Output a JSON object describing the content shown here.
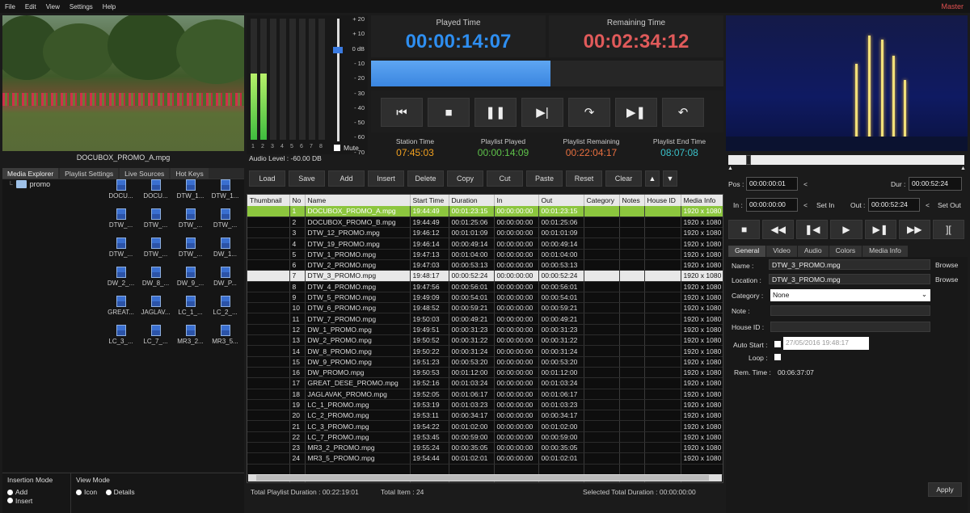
{
  "menu": {
    "items": [
      "File",
      "Edit",
      "View",
      "Settings",
      "Help"
    ],
    "mode": "Master"
  },
  "preview": {
    "caption": "DOCUBOX_PROMO_A.mpg"
  },
  "media_tabs": [
    "Media Explorer",
    "Playlist Settings",
    "Live Sources",
    "Hot Keys"
  ],
  "explorer": {
    "folder": "promo",
    "files": [
      "DOCU...",
      "DOCU...",
      "DTW_1...",
      "DTW_1...",
      "DTW_...",
      "DTW_...",
      "DTW_...",
      "DTW_...",
      "DTW_...",
      "DTW_...",
      "DTW_...",
      "DW_1...",
      "DW_2_...",
      "DW_8_...",
      "DW_9_...",
      "DW_P...",
      "GREAT...",
      "JAGLAV...",
      "LC_1_...",
      "LC_2_...",
      "LC_3_...",
      "LC_7_...",
      "MR3_2...",
      "MR3_5..."
    ]
  },
  "modes": {
    "insertion_title": "Insertion Mode",
    "insertion": [
      "Add",
      "Insert"
    ],
    "view_title": "View Mode",
    "view": [
      "Icon",
      "Details"
    ]
  },
  "audio": {
    "level_label": "Audio Level :",
    "level_value": "-60.00",
    "level_unit": "DB",
    "channels": [
      "1",
      "2",
      "3",
      "4",
      "5",
      "6",
      "7",
      "8"
    ],
    "scale": [
      "+ 20",
      "+ 10",
      "0 dB",
      "- 10",
      "- 20",
      "- 30",
      "- 40",
      "- 50",
      "- 60",
      "- 70"
    ],
    "mute": "Mute",
    "channel_levels": [
      0.55,
      0.55,
      0,
      0,
      0,
      0,
      0,
      0
    ]
  },
  "times": {
    "played_label": "Played Time",
    "played": "00:00:14:07",
    "remaining_label": "Remaining Time",
    "remaining": "00:02:34:12",
    "played_color": "#2e8ef0",
    "remaining_color": "#e05a5a"
  },
  "transport": {
    "buttons": [
      "skip-start-icon",
      "stop-icon",
      "pause-icon",
      "play-next-icon",
      "jump-icon",
      "next-item-icon",
      "return-icon"
    ]
  },
  "stats": [
    {
      "label": "Station Time",
      "value": "07:45:03",
      "color": "#f0a020"
    },
    {
      "label": "Playlist Played",
      "value": "00:00:14:09",
      "color": "#5ec24a"
    },
    {
      "label": "Playlist Remaining",
      "value": "00:22:04:17",
      "color": "#e87040"
    },
    {
      "label": "Playlist End Time",
      "value": "08:07:08",
      "color": "#3ac0c8"
    }
  ],
  "toolbar": [
    "Load",
    "Save",
    "Add",
    "Insert",
    "Delete",
    "Copy",
    "Cut",
    "Paste",
    "Reset",
    "Clear"
  ],
  "playlist": {
    "columns": [
      "Thumbnail",
      "No",
      "Name",
      "Start Time",
      "Duration",
      "In",
      "Out",
      "Category",
      "Notes",
      "House ID",
      "Media Info"
    ],
    "rows": [
      [
        "",
        "1",
        "DOCUBOX_PROMO_A.mpg",
        "19:44:49",
        "00:01:23:15",
        "00:00:00:00",
        "00:01:23:15",
        "",
        "",
        "",
        "1920 x 1080"
      ],
      [
        "",
        "2",
        "DOCUBOX_PROMO_B.mpg",
        "19:44:49",
        "00:01:25:06",
        "00:00:00:00",
        "00:01:25:06",
        "",
        "",
        "",
        "1920 x 1080"
      ],
      [
        "",
        "3",
        "DTW_12_PROMO.mpg",
        "19:46:12",
        "00:01:01:09",
        "00:00:00:00",
        "00:01:01:09",
        "",
        "",
        "",
        "1920 x 1080"
      ],
      [
        "",
        "4",
        "DTW_19_PROMO.mpg",
        "19:46:14",
        "00:00:49:14",
        "00:00:00:00",
        "00:00:49:14",
        "",
        "",
        "",
        "1920 x 1080"
      ],
      [
        "",
        "5",
        "DTW_1_PROMO.mpg",
        "19:47:13",
        "00:01:04:00",
        "00:00:00:00",
        "00:01:04:00",
        "",
        "",
        "",
        "1920 x 1080"
      ],
      [
        "",
        "6",
        "DTW_2_PROMO.mpg",
        "19:47:03",
        "00:00:53:13",
        "00:00:00:00",
        "00:00:53:13",
        "",
        "",
        "",
        "1920 x 1080"
      ],
      [
        "",
        "7",
        "DTW_3_PROMO.mpg",
        "19:48:17",
        "00:00:52:24",
        "00:00:00:00",
        "00:00:52:24",
        "",
        "",
        "",
        "1920 x 1080"
      ],
      [
        "",
        "8",
        "DTW_4_PROMO.mpg",
        "19:47:56",
        "00:00:56:01",
        "00:00:00:00",
        "00:00:56:01",
        "",
        "",
        "",
        "1920 x 1080"
      ],
      [
        "",
        "9",
        "DTW_5_PROMO.mpg",
        "19:49:09",
        "00:00:54:01",
        "00:00:00:00",
        "00:00:54:01",
        "",
        "",
        "",
        "1920 x 1080"
      ],
      [
        "",
        "10",
        "DTW_6_PROMO.mpg",
        "19:48:52",
        "00:00:59:21",
        "00:00:00:00",
        "00:00:59:21",
        "",
        "",
        "",
        "1920 x 1080"
      ],
      [
        "",
        "11",
        "DTW_7_PROMO.mpg",
        "19:50:03",
        "00:00:49:21",
        "00:00:00:00",
        "00:00:49:21",
        "",
        "",
        "",
        "1920 x 1080"
      ],
      [
        "",
        "12",
        "DW_1_PROMO.mpg",
        "19:49:51",
        "00:00:31:23",
        "00:00:00:00",
        "00:00:31:23",
        "",
        "",
        "",
        "1920 x 1080"
      ],
      [
        "",
        "13",
        "DW_2_PROMO.mpg",
        "19:50:52",
        "00:00:31:22",
        "00:00:00:00",
        "00:00:31:22",
        "",
        "",
        "",
        "1920 x 1080"
      ],
      [
        "",
        "14",
        "DW_8_PROMO.mpg",
        "19:50:22",
        "00:00:31:24",
        "00:00:00:00",
        "00:00:31:24",
        "",
        "",
        "",
        "1920 x 1080"
      ],
      [
        "",
        "15",
        "DW_9_PROMO.mpg",
        "19:51:23",
        "00:00:53:20",
        "00:00:00:00",
        "00:00:53:20",
        "",
        "",
        "",
        "1920 x 1080"
      ],
      [
        "",
        "16",
        "DW_PROMO.mpg",
        "19:50:53",
        "00:01:12:00",
        "00:00:00:00",
        "00:01:12:00",
        "",
        "",
        "",
        "1920 x 1080"
      ],
      [
        "",
        "17",
        "GREAT_DESE_PROMO.mpg",
        "19:52:16",
        "00:01:03:24",
        "00:00:00:00",
        "00:01:03:24",
        "",
        "",
        "",
        "1920 x 1080"
      ],
      [
        "",
        "18",
        "JAGLAVAK_PROMO.mpg",
        "19:52:05",
        "00:01:06:17",
        "00:00:00:00",
        "00:01:06:17",
        "",
        "",
        "",
        "1920 x 1080"
      ],
      [
        "",
        "19",
        "LC_1_PROMO.mpg",
        "19:53:19",
        "00:01:03:23",
        "00:00:00:00",
        "00:01:03:23",
        "",
        "",
        "",
        "1920 x 1080"
      ],
      [
        "",
        "20",
        "LC_2_PROMO.mpg",
        "19:53:11",
        "00:00:34:17",
        "00:00:00:00",
        "00:00:34:17",
        "",
        "",
        "",
        "1920 x 1080"
      ],
      [
        "",
        "21",
        "LC_3_PROMO.mpg",
        "19:54:22",
        "00:01:02:00",
        "00:00:00:00",
        "00:01:02:00",
        "",
        "",
        "",
        "1920 x 1080"
      ],
      [
        "",
        "22",
        "LC_7_PROMO.mpg",
        "19:53:45",
        "00:00:59:00",
        "00:00:00:00",
        "00:00:59:00",
        "",
        "",
        "",
        "1920 x 1080"
      ],
      [
        "",
        "23",
        "MR3_2_PROMO.mpg",
        "19:55:24",
        "00:00:35:05",
        "00:00:00:00",
        "00:00:35:05",
        "",
        "",
        "",
        "1920 x 1080"
      ],
      [
        "",
        "24",
        "MR3_5_PROMO.mpg",
        "19:54:44",
        "00:01:02:01",
        "00:00:00:00",
        "00:01:02:01",
        "",
        "",
        "",
        "1920 x 1080"
      ]
    ]
  },
  "footer": {
    "total_duration_label": "Total Playlist Duration :",
    "total_duration": "00:22:19:01",
    "total_item_label": "Total Item :",
    "total_item": "24",
    "selected_label": "Selected Total Duration :",
    "selected": "00:00:00:00"
  },
  "player": {
    "pos_label": "Pos :",
    "pos": "00:00:00:01",
    "dur_label": "Dur :",
    "dur": "00:00:52:24",
    "in_label": "In :",
    "in": "00:00:00:00",
    "set_in": "Set In",
    "out_label": "Out :",
    "out": "00:00:52:24",
    "set_out": "Set Out",
    "buttons": [
      "stop-icon",
      "rewind-icon",
      "step-back-icon",
      "play-icon",
      "step-forward-icon",
      "fast-forward-icon",
      "mark-icon"
    ]
  },
  "prop_tabs": [
    "General",
    "Video",
    "Audio",
    "Colors",
    "Media Info"
  ],
  "props": {
    "name_label": "Name :",
    "name": "DTW_3_PROMO.mpg",
    "browse": "Browse",
    "location_label": "Location :",
    "location": "DTW_3_PROMO.mpg",
    "category_label": "Category :",
    "category": "None",
    "note_label": "Note :",
    "house_label": "House ID :",
    "auto_start_label": "Auto Start :",
    "auto_start_date": "27/05/2016 19:48:17",
    "loop_label": "Loop :",
    "rem_label": "Rem. Time :",
    "rem": "00:06:37:07",
    "apply": "Apply"
  }
}
